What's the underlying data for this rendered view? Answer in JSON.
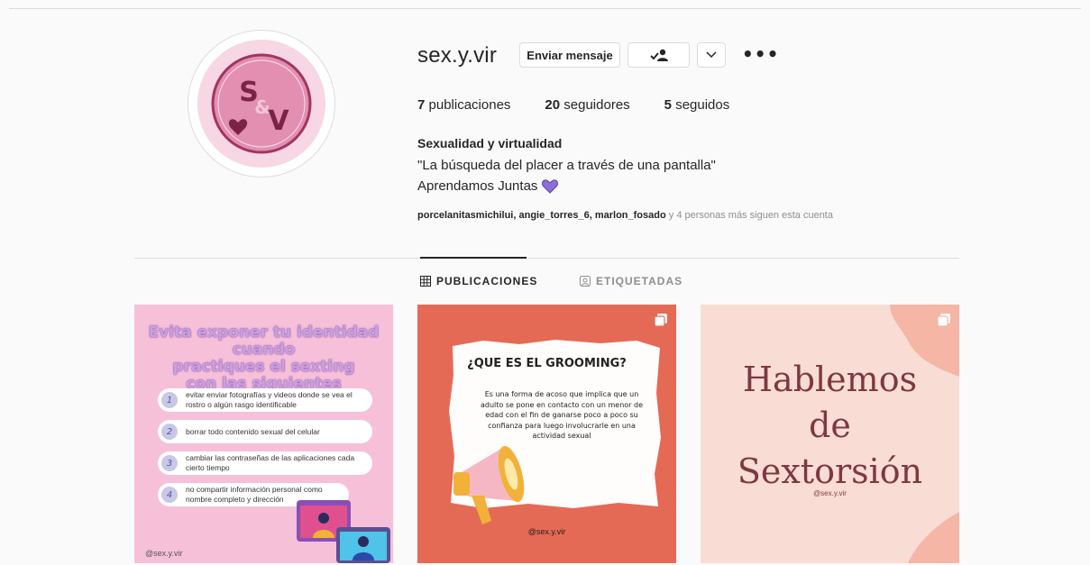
{
  "profile": {
    "username": "sex.y.vir",
    "buttons": {
      "message": "Enviar mensaje"
    },
    "stats": [
      {
        "count": "7",
        "label": "publicaciones"
      },
      {
        "count": "20",
        "label": "seguidores"
      },
      {
        "count": "5",
        "label": "seguidos"
      }
    ],
    "full_name": "Sexualidad y virtualidad",
    "bio_line1": "\"La búsqueda del placer a través de una pantalla\"",
    "bio_line2": "Aprendamos Juntas",
    "followed_by_names": "porcelanitasmichilui, angie_torres_6, marlon_fosado",
    "followed_by_suffix": " y 4 personas más siguen esta cuenta",
    "avatar_letters": "S&V"
  },
  "tabs": [
    {
      "label": "PUBLICACIONES",
      "icon": "grid-icon",
      "active": true
    },
    {
      "label": "ETIQUETADAS",
      "icon": "tag-user-icon",
      "active": false
    }
  ],
  "posts": [
    {
      "title_lines": [
        "Evita exponer tu identidad cuando",
        "practiques el sexting",
        "con las siguientes recomendaciones"
      ],
      "items": [
        {
          "num": "1",
          "text": "evitar enviar fotografías y videos donde se vea el rostro o algún rasgo identificable"
        },
        {
          "num": "2",
          "text": "borrar todo contenido sexual del celular"
        },
        {
          "num": "3",
          "text": "cambiar las contraseñas de las aplicaciones cada cierto tiempo"
        },
        {
          "num": "4",
          "text": "no compartir información personal como nombre completo y dirección"
        }
      ],
      "handle": "@sex.y.vir"
    },
    {
      "title": "¿QUE ES EL GROOMING?",
      "body": "Es una forma de acoso que implica que un adulto se pone en contacto con un menor de edad con el fin de ganarse poco a poco su confianza para luego involucrarle en una actividad sexual",
      "handle": "@sex.y.vir"
    },
    {
      "text_lines": [
        "Hablemos",
        "de",
        "Sextorsión"
      ],
      "handle": "@sex.y.vir"
    }
  ],
  "colors": {
    "accent_heart": "#8c6fd6",
    "post1_bg": "#f7c0d9",
    "post2_bg": "#e56a55",
    "post3_bg": "#f9ddd4",
    "post3_text": "#7e3842"
  }
}
